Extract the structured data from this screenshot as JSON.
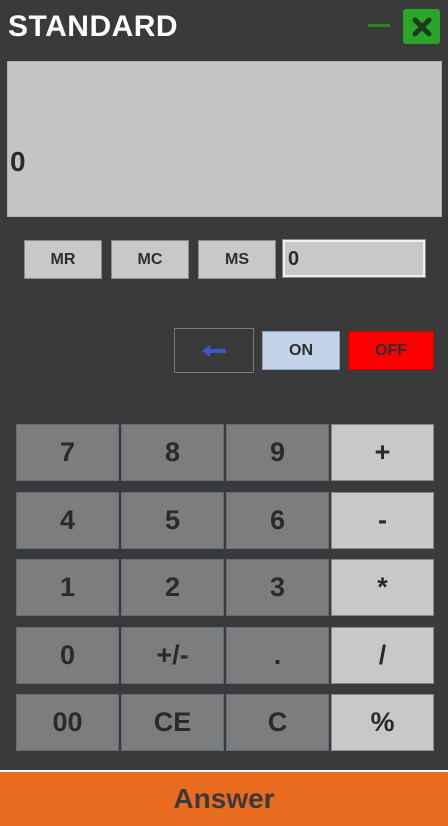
{
  "window": {
    "title": "STANDARD",
    "minimize_icon": "minimize-icon",
    "close_icon": "close-x-icon"
  },
  "display": {
    "value": "0"
  },
  "memory": {
    "mr_label": "MR",
    "mc_label": "MC",
    "ms_label": "MS",
    "value": "0"
  },
  "controls": {
    "backspace_icon": "left-arrow-icon",
    "on_label": "ON",
    "off_label": "OFF"
  },
  "keypad": {
    "rows": [
      [
        "7",
        "8",
        "9",
        "+"
      ],
      [
        "4",
        "5",
        "6",
        "-"
      ],
      [
        "1",
        "2",
        "3",
        "*"
      ],
      [
        "0",
        "+/-",
        ".",
        "/"
      ],
      [
        "00",
        "CE",
        "C",
        "%"
      ]
    ]
  },
  "answer_label": "Answer",
  "colors": {
    "background": "#3a3a3a",
    "display": "#c4c4c4",
    "number_key": "#7d7d7d",
    "operator_key": "#c8c8c8",
    "on_button": "#c3d4e8",
    "off_button": "#ff0000",
    "answer_bar": "#e86b1f",
    "close_button": "#2aa52a",
    "back_arrow": "#3f56c8"
  }
}
